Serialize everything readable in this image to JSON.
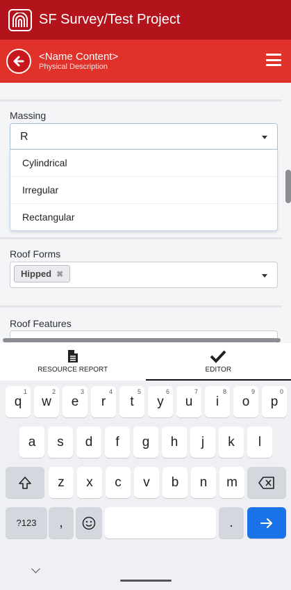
{
  "app": {
    "title": "SF Survey/Test Project",
    "icon": "arch-logo-icon"
  },
  "nav": {
    "title": "<Name Content>",
    "subtitle": "Physical Description",
    "back_icon": "back-arrow-icon",
    "menu_icon": "hamburger-menu-icon"
  },
  "form": {
    "massing": {
      "label": "Massing",
      "value": "R",
      "options": [
        "Cylindrical",
        "Irregular",
        "Rectangular"
      ]
    },
    "roof_forms": {
      "label": "Roof Forms",
      "chip": "Hipped",
      "chip_remove": "✖"
    },
    "roof_features": {
      "label": "Roof Features"
    }
  },
  "tabs": [
    {
      "label": "RESOURCE REPORT",
      "icon": "document-icon",
      "active": false
    },
    {
      "label": "EDITOR",
      "icon": "checkmark-icon",
      "active": true
    }
  ],
  "keyboard": {
    "row1": [
      {
        "k": "q",
        "h": "1"
      },
      {
        "k": "w",
        "h": "2"
      },
      {
        "k": "e",
        "h": "3"
      },
      {
        "k": "r",
        "h": "4"
      },
      {
        "k": "t",
        "h": "5"
      },
      {
        "k": "y",
        "h": "6"
      },
      {
        "k": "u",
        "h": "7"
      },
      {
        "k": "i",
        "h": "8"
      },
      {
        "k": "o",
        "h": "9"
      },
      {
        "k": "p",
        "h": "0"
      }
    ],
    "row2": [
      "a",
      "s",
      "d",
      "f",
      "g",
      "h",
      "j",
      "k",
      "l"
    ],
    "row3": [
      "z",
      "x",
      "c",
      "v",
      "b",
      "n",
      "m"
    ],
    "sym": "?123",
    "comma": ",",
    "period": ".",
    "shift_icon": "shift-icon",
    "backspace_icon": "backspace-icon",
    "emoji_icon": "emoji-icon",
    "enter_icon": "enter-arrow-icon"
  },
  "colors": {
    "title_bar": "#b3141c",
    "nav_bar": "#e0312b",
    "enter_key": "#1a73e8"
  }
}
